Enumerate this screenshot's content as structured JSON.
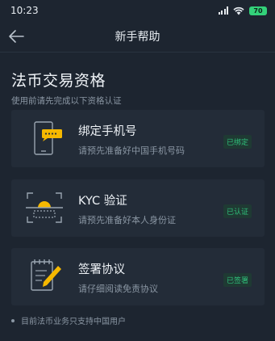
{
  "status_bar": {
    "time": "10:23",
    "battery": "70"
  },
  "nav": {
    "title": "新手帮助"
  },
  "section": {
    "title": "法币交易资格",
    "subtitle": "使用前请先完成以下资格认证"
  },
  "cards": [
    {
      "icon": "phone-icon",
      "title": "绑定手机号",
      "desc": "请预先准备好中国手机号码",
      "badge": "已绑定"
    },
    {
      "icon": "id-scan-icon",
      "title": "KYC 验证",
      "desc": "请预先准备好本人身份证",
      "badge": "已认证"
    },
    {
      "icon": "agreement-icon",
      "title": "签署协议",
      "desc": "请仔细阅读免责协议",
      "badge": "已签署"
    }
  ],
  "footnote": "目前法币业务只支持中国用户",
  "colors": {
    "accent": "#f5b800",
    "success": "#2fbf7a",
    "background": "#1d2530",
    "card": "#232c38"
  }
}
